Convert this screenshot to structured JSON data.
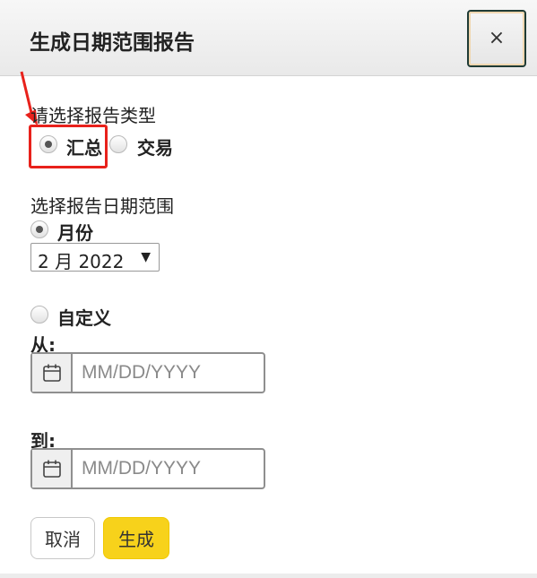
{
  "dialog": {
    "title": "生成日期范围报告",
    "close_symbol": "×"
  },
  "report_type": {
    "label": "请选择报告类型",
    "options": [
      {
        "label": "汇总",
        "checked": true
      },
      {
        "label": "交易",
        "checked": false
      }
    ]
  },
  "date_range": {
    "label": "选择报告日期范围",
    "month_option": {
      "label": "月份",
      "checked": true
    },
    "month_select": {
      "value": "2 月 2022"
    },
    "custom_option": {
      "label": "自定义",
      "checked": false
    },
    "from": {
      "label": "从:",
      "placeholder": "MM/DD/YYYY",
      "value": ""
    },
    "to": {
      "label": "到:",
      "placeholder": "MM/DD/YYYY",
      "value": ""
    }
  },
  "buttons": {
    "cancel_label": "取消",
    "generate_label": "生成"
  },
  "icons": {
    "close": "close-icon",
    "calendar": "calendar-icon",
    "dropdown": "chevron-down-icon",
    "annotation": "red-arrow"
  },
  "colors": {
    "accent_yellow": "#f7d21b",
    "annotation_red": "#e8211b"
  }
}
